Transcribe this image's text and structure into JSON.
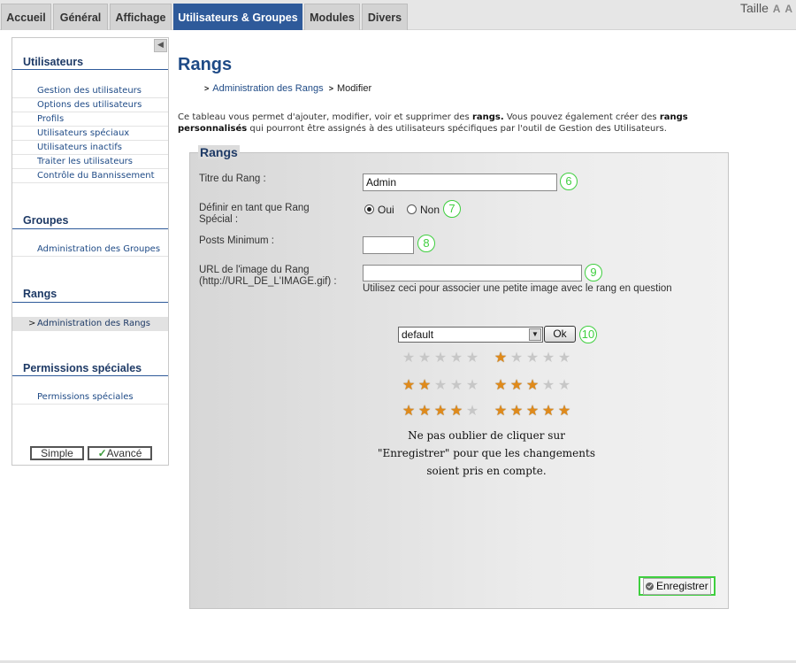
{
  "tabs": [
    {
      "label": "Accueil",
      "active": false
    },
    {
      "label": "Général",
      "active": false
    },
    {
      "label": "Affichage",
      "active": false
    },
    {
      "label": "Utilisateurs & Groupes",
      "active": true
    },
    {
      "label": "Modules",
      "active": false
    },
    {
      "label": "Divers",
      "active": false
    }
  ],
  "size_control": {
    "label": "Taille",
    "icons": [
      "font-increase-icon",
      "font-decrease-icon"
    ],
    "glyph": "A"
  },
  "sidebar": {
    "collapse_icon": "collapse-arrow-icon",
    "sections": [
      {
        "title": "Utilisateurs",
        "items": [
          {
            "label": "Gestion des utilisateurs"
          },
          {
            "label": "Options des utilisateurs"
          },
          {
            "label": "Profils"
          },
          {
            "label": "Utilisateurs spéciaux"
          },
          {
            "label": "Utilisateurs inactifs"
          },
          {
            "label": "Traiter les utilisateurs"
          },
          {
            "label": "Contrôle du Bannissement"
          }
        ]
      },
      {
        "title": "Groupes",
        "items": [
          {
            "label": "Administration des Groupes"
          }
        ]
      },
      {
        "title": "Rangs",
        "items": [
          {
            "label": "Administration des Rangs",
            "selected": true,
            "marker": ">"
          }
        ]
      },
      {
        "title": "Permissions spéciales",
        "items": [
          {
            "label": "Permissions spéciales"
          }
        ]
      }
    ],
    "mode_buttons": {
      "simple": "Simple",
      "advanced": "Avancé",
      "advanced_check": "✓"
    }
  },
  "main": {
    "title": "Rangs",
    "breadcrumb": {
      "sep": ">",
      "link": "Administration des Rangs",
      "current": "Modifier"
    },
    "intro": {
      "p1": "Ce tableau vous permet d'ajouter, modifier, voir et supprimer des ",
      "b1": "rangs.",
      "p2": " Vous pouvez également créer des ",
      "b2": "rangs personnalisés",
      "p3": " qui pourront être assignés à des utilisateurs spécifiques par l'outil de Gestion des Utilisateurs."
    },
    "form": {
      "legend": "Rangs",
      "rank_title": {
        "label": "Titre du Rang :",
        "value": "Admin",
        "marker": "6"
      },
      "special": {
        "label_line1": "Définir en tant que Rang",
        "label_line2": "Spécial :",
        "yes": "Oui",
        "no": "Non",
        "selected": "Oui",
        "marker": "7"
      },
      "min_posts": {
        "label": "Posts Minimum :",
        "value": "",
        "marker": "8"
      },
      "image_url": {
        "label_line1": "URL de l'image du Rang",
        "label_line2": "(http://URL_DE_L'IMAGE.gif) :",
        "value": "",
        "help": "Utilisez ceci pour associer une petite image avec le rang en question",
        "marker": "9"
      },
      "image_select": {
        "value": "default",
        "arrow": "▼",
        "ok_label": "Ok",
        "marker": "10"
      },
      "star_sets": [
        0,
        1,
        2,
        3,
        4,
        5
      ],
      "star_max": 5,
      "star_glyph": "★",
      "reminder": "Ne pas oublier de cliquer sur \"Enregistrer\" pour que les changements soient pris en compte.",
      "save_label": "Enregistrer"
    }
  },
  "colors": {
    "accent": "#2e5a9a",
    "marker": "#3fcf3f",
    "star_on": "#e08a1a",
    "star_off": "#c7c7c7"
  }
}
